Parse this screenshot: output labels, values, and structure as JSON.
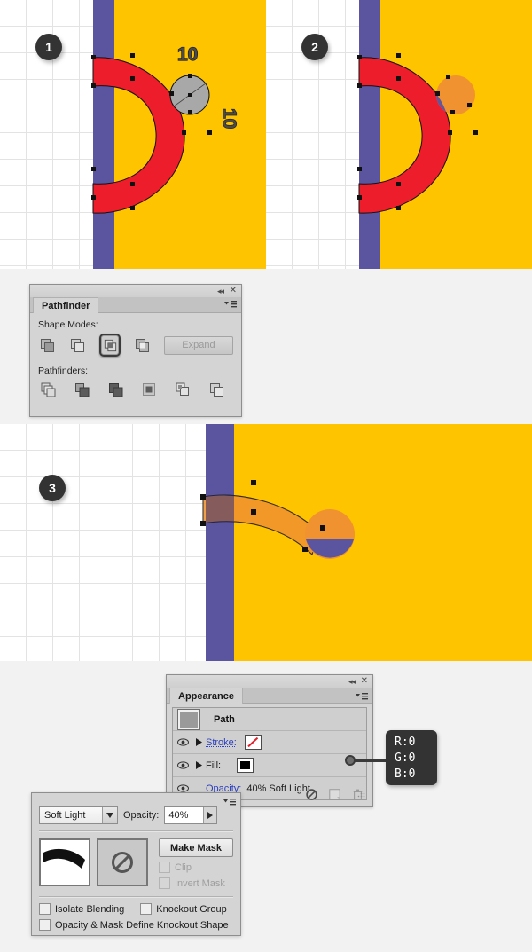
{
  "steps": [
    {
      "number": "1"
    },
    {
      "number": "2"
    },
    {
      "number": "3"
    }
  ],
  "artboard": {
    "measure_label_w": "10",
    "measure_label_h": "10",
    "colors": {
      "background_yellow": "#FFC400",
      "stripe_purple": "#5B549F",
      "letter_red": "#EE1D2B",
      "highlight_orange": "#F0922F",
      "selection_gray": "#A8A8A8",
      "grid_line": "#E3E3E3",
      "canvas_white": "#FFFFFF",
      "page_background": "#F2F2F2"
    }
  },
  "pathfinder_panel": {
    "title": "Pathfinder",
    "shape_modes_label": "Shape Modes:",
    "pathfinders_label": "Pathfinders:",
    "expand_label": "Expand",
    "expand_enabled": false,
    "shape_modes": [
      {
        "name": "unite",
        "selected": false
      },
      {
        "name": "minus-front",
        "selected": false
      },
      {
        "name": "intersect",
        "selected": true
      },
      {
        "name": "exclude",
        "selected": false
      }
    ],
    "pathfinders": [
      {
        "name": "divide"
      },
      {
        "name": "trim"
      },
      {
        "name": "merge"
      },
      {
        "name": "crop"
      },
      {
        "name": "outline"
      },
      {
        "name": "minus-back"
      }
    ],
    "window_controls": {
      "collapse": "◂◂",
      "close": "✕",
      "menu": "▾☰"
    }
  },
  "appearance_panel": {
    "title": "Appearance",
    "rows": [
      {
        "name": "Path",
        "type": "object",
        "eye": false,
        "disclosure": false
      },
      {
        "name": "Stroke:",
        "type": "stroke",
        "eye": true,
        "disclosure": true,
        "swatch": "none-red-slash",
        "link": true
      },
      {
        "name": "Fill:",
        "type": "fill",
        "eye": true,
        "disclosure": true,
        "swatch": "#000000",
        "link": false
      },
      {
        "name": "Opacity:",
        "type": "opacity",
        "eye": true,
        "disclosure": false,
        "value": "40% Soft Light",
        "link": true
      }
    ],
    "footer_icons": [
      {
        "name": "add-new-effect-icon"
      },
      {
        "name": "duplicate-item-icon"
      },
      {
        "name": "delete-item-icon"
      }
    ],
    "window_controls": {
      "collapse": "◂◂",
      "close": "✕",
      "menu": "▾☰"
    }
  },
  "rgb_callout": {
    "r": "R:0",
    "g": "G:0",
    "b": "B:0"
  },
  "transparency_panel": {
    "blend_mode": "Soft Light",
    "blend_modes_available": [
      "Soft Light"
    ],
    "opacity_label": "Opacity:",
    "opacity_value": "40%",
    "make_mask_label": "Make Mask",
    "clip_label": "Clip",
    "clip_enabled": false,
    "clip_checked": false,
    "invert_mask_label": "Invert Mask",
    "invert_mask_enabled": false,
    "invert_mask_checked": false,
    "isolate_blending_label": "Isolate Blending",
    "isolate_blending_checked": false,
    "knockout_group_label": "Knockout Group",
    "knockout_group_checked": false,
    "knockout_shape_label": "Opacity & Mask Define Knockout Shape",
    "knockout_shape_checked": false,
    "menu_icon": "▾☰"
  }
}
